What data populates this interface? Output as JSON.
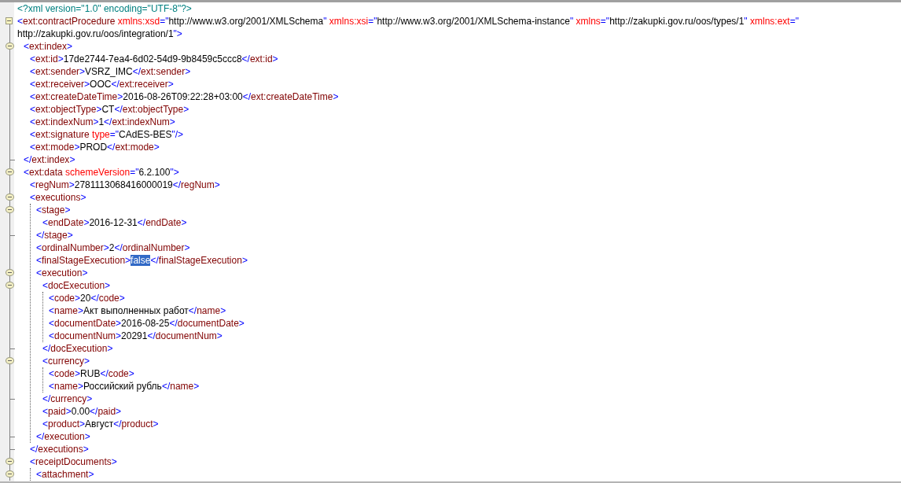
{
  "document": [
    {
      "lines": [
        [
          {
            "decl": "<?xml version=\"1.0\" encoding=\"UTF-8\"?>"
          }
        ]
      ]
    },
    {
      "expanded": true,
      "lines": [
        [
          {
            "punct": "<"
          },
          {
            "tag": "ext:contractProcedure"
          },
          {
            "attr": "xmlns:xsd"
          },
          {
            "punct": "=\""
          },
          {
            "text": "http://www.w3.org/2001/XMLSchema"
          },
          {
            "punct": "\""
          },
          {
            "attr": "xmlns:xsi"
          },
          {
            "punct": "=\""
          },
          {
            "text": "http://www.w3.org/2001/XMLSchema-instance"
          },
          {
            "punct": "\""
          },
          {
            "attr": "xmlns"
          },
          {
            "punct": "=\""
          },
          {
            "text": "http://zakupki.gov.ru/oos/types/1"
          },
          {
            "punct": "\""
          },
          {
            "attr": "xmlns:ext"
          },
          {
            "punct": "=\""
          }
        ],
        [
          {
            "text": "http://zakupki.gov.ru/oos/integration/1"
          },
          {
            "punct": "\">"
          }
        ]
      ],
      "children": [
        {
          "expanded": true,
          "lines": [
            [
              {
                "punct": "<"
              },
              {
                "tag": "ext:index"
              },
              {
                "punct": ">"
              }
            ]
          ],
          "close": [
            {
              "punct": "</"
            },
            {
              "tag": "ext:index"
            },
            {
              "punct": ">"
            }
          ],
          "children": [
            {
              "lines": [
                [
                  {
                    "punct": "<"
                  },
                  {
                    "tag": "ext:id"
                  },
                  {
                    "punct": ">"
                  },
                  {
                    "text": "17de2744-7ea4-6d02-54d9-9b8459c5ccc8"
                  },
                  {
                    "punct": "</"
                  },
                  {
                    "tag": "ext:id"
                  },
                  {
                    "punct": ">"
                  }
                ]
              ]
            },
            {
              "lines": [
                [
                  {
                    "punct": "<"
                  },
                  {
                    "tag": "ext:sender"
                  },
                  {
                    "punct": ">"
                  },
                  {
                    "text": "VSRZ_IMC"
                  },
                  {
                    "punct": "</"
                  },
                  {
                    "tag": "ext:sender"
                  },
                  {
                    "punct": ">"
                  }
                ]
              ]
            },
            {
              "lines": [
                [
                  {
                    "punct": "<"
                  },
                  {
                    "tag": "ext:receiver"
                  },
                  {
                    "punct": ">"
                  },
                  {
                    "text": "OOC"
                  },
                  {
                    "punct": "</"
                  },
                  {
                    "tag": "ext:receiver"
                  },
                  {
                    "punct": ">"
                  }
                ]
              ]
            },
            {
              "lines": [
                [
                  {
                    "punct": "<"
                  },
                  {
                    "tag": "ext:createDateTime"
                  },
                  {
                    "punct": ">"
                  },
                  {
                    "text": "2016-08-26T09:22:28+03:00"
                  },
                  {
                    "punct": "</"
                  },
                  {
                    "tag": "ext:createDateTime"
                  },
                  {
                    "punct": ">"
                  }
                ]
              ]
            },
            {
              "lines": [
                [
                  {
                    "punct": "<"
                  },
                  {
                    "tag": "ext:objectType"
                  },
                  {
                    "punct": ">"
                  },
                  {
                    "text": "CT"
                  },
                  {
                    "punct": "</"
                  },
                  {
                    "tag": "ext:objectType"
                  },
                  {
                    "punct": ">"
                  }
                ]
              ]
            },
            {
              "lines": [
                [
                  {
                    "punct": "<"
                  },
                  {
                    "tag": "ext:indexNum"
                  },
                  {
                    "punct": ">"
                  },
                  {
                    "text": "1"
                  },
                  {
                    "punct": "</"
                  },
                  {
                    "tag": "ext:indexNum"
                  },
                  {
                    "punct": ">"
                  }
                ]
              ]
            },
            {
              "lines": [
                [
                  {
                    "punct": "<"
                  },
                  {
                    "tag": "ext:signature"
                  },
                  {
                    "attr": "type"
                  },
                  {
                    "punct": "=\""
                  },
                  {
                    "text": "CAdES-BES"
                  },
                  {
                    "punct": "\"/>"
                  }
                ]
              ]
            },
            {
              "lines": [
                [
                  {
                    "punct": "<"
                  },
                  {
                    "tag": "ext:mode"
                  },
                  {
                    "punct": ">"
                  },
                  {
                    "text": "PROD"
                  },
                  {
                    "punct": "</"
                  },
                  {
                    "tag": "ext:mode"
                  },
                  {
                    "punct": ">"
                  }
                ]
              ]
            }
          ]
        },
        {
          "expanded": true,
          "lines": [
            [
              {
                "punct": "<"
              },
              {
                "tag": "ext:data"
              },
              {
                "attr": "schemeVersion"
              },
              {
                "punct": "=\""
              },
              {
                "text": "6.2.100"
              },
              {
                "punct": "\">"
              }
            ]
          ],
          "children": [
            {
              "lines": [
                [
                  {
                    "punct": "<"
                  },
                  {
                    "tag": "regNum"
                  },
                  {
                    "punct": ">"
                  },
                  {
                    "text": "2781113068416000019"
                  },
                  {
                    "punct": "</"
                  },
                  {
                    "tag": "regNum"
                  },
                  {
                    "punct": ">"
                  }
                ]
              ]
            },
            {
              "expanded": true,
              "guide": true,
              "lines": [
                [
                  {
                    "punct": "<"
                  },
                  {
                    "tag": "executions"
                  },
                  {
                    "punct": ">"
                  }
                ]
              ],
              "close": [
                {
                  "punct": "</"
                },
                {
                  "tag": "executions"
                },
                {
                  "punct": ">"
                }
              ],
              "children": [
                {
                  "expanded": true,
                  "lines": [
                    [
                      {
                        "punct": "<"
                      },
                      {
                        "tag": "stage"
                      },
                      {
                        "punct": ">"
                      }
                    ]
                  ],
                  "close": [
                    {
                      "punct": "</"
                    },
                    {
                      "tag": "stage"
                    },
                    {
                      "punct": ">"
                    }
                  ],
                  "children": [
                    {
                      "lines": [
                        [
                          {
                            "punct": "<"
                          },
                          {
                            "tag": "endDate"
                          },
                          {
                            "punct": ">"
                          },
                          {
                            "text": "2016-12-31"
                          },
                          {
                            "punct": "</"
                          },
                          {
                            "tag": "endDate"
                          },
                          {
                            "punct": ">"
                          }
                        ]
                      ]
                    }
                  ]
                },
                {
                  "lines": [
                    [
                      {
                        "punct": "<"
                      },
                      {
                        "tag": "ordinalNumber"
                      },
                      {
                        "punct": ">"
                      },
                      {
                        "text": "2"
                      },
                      {
                        "punct": "</"
                      },
                      {
                        "tag": "ordinalNumber"
                      },
                      {
                        "punct": ">"
                      }
                    ]
                  ]
                },
                {
                  "lines": [
                    [
                      {
                        "punct": "<"
                      },
                      {
                        "tag": "finalStageExecution"
                      },
                      {
                        "punct": ">"
                      },
                      {
                        "selected_text": "false"
                      },
                      {
                        "punct": "</"
                      },
                      {
                        "tag": "finalStageExecution"
                      },
                      {
                        "punct": ">"
                      }
                    ]
                  ]
                },
                {
                  "expanded": true,
                  "lines": [
                    [
                      {
                        "punct": "<"
                      },
                      {
                        "tag": "execution"
                      },
                      {
                        "punct": ">"
                      }
                    ]
                  ],
                  "close": [
                    {
                      "punct": "</"
                    },
                    {
                      "tag": "execution"
                    },
                    {
                      "punct": ">"
                    }
                  ],
                  "children": [
                    {
                      "expanded": true,
                      "guide": true,
                      "lines": [
                        [
                          {
                            "punct": "<"
                          },
                          {
                            "tag": "docExecution"
                          },
                          {
                            "punct": ">"
                          }
                        ]
                      ],
                      "close": [
                        {
                          "punct": "</"
                        },
                        {
                          "tag": "docExecution"
                        },
                        {
                          "punct": ">"
                        }
                      ],
                      "children": [
                        {
                          "lines": [
                            [
                              {
                                "punct": "<"
                              },
                              {
                                "tag": "code"
                              },
                              {
                                "punct": ">"
                              },
                              {
                                "text": "20"
                              },
                              {
                                "punct": "</"
                              },
                              {
                                "tag": "code"
                              },
                              {
                                "punct": ">"
                              }
                            ]
                          ]
                        },
                        {
                          "lines": [
                            [
                              {
                                "punct": "<"
                              },
                              {
                                "tag": "name"
                              },
                              {
                                "punct": ">"
                              },
                              {
                                "text": "Акт выполненных работ"
                              },
                              {
                                "punct": "</"
                              },
                              {
                                "tag": "name"
                              },
                              {
                                "punct": ">"
                              }
                            ]
                          ]
                        },
                        {
                          "lines": [
                            [
                              {
                                "punct": "<"
                              },
                              {
                                "tag": "documentDate"
                              },
                              {
                                "punct": ">"
                              },
                              {
                                "text": "2016-08-25"
                              },
                              {
                                "punct": "</"
                              },
                              {
                                "tag": "documentDate"
                              },
                              {
                                "punct": ">"
                              }
                            ]
                          ]
                        },
                        {
                          "lines": [
                            [
                              {
                                "punct": "<"
                              },
                              {
                                "tag": "documentNum"
                              },
                              {
                                "punct": ">"
                              },
                              {
                                "text": "20291"
                              },
                              {
                                "punct": "</"
                              },
                              {
                                "tag": "documentNum"
                              },
                              {
                                "punct": ">"
                              }
                            ]
                          ]
                        }
                      ]
                    },
                    {
                      "expanded": true,
                      "guide": true,
                      "lines": [
                        [
                          {
                            "punct": "<"
                          },
                          {
                            "tag": "currency"
                          },
                          {
                            "punct": ">"
                          }
                        ]
                      ],
                      "close": [
                        {
                          "punct": "</"
                        },
                        {
                          "tag": "currency"
                        },
                        {
                          "punct": ">"
                        }
                      ],
                      "children": [
                        {
                          "lines": [
                            [
                              {
                                "punct": "<"
                              },
                              {
                                "tag": "code"
                              },
                              {
                                "punct": ">"
                              },
                              {
                                "text": "RUB"
                              },
                              {
                                "punct": "</"
                              },
                              {
                                "tag": "code"
                              },
                              {
                                "punct": ">"
                              }
                            ]
                          ]
                        },
                        {
                          "lines": [
                            [
                              {
                                "punct": "<"
                              },
                              {
                                "tag": "name"
                              },
                              {
                                "punct": ">"
                              },
                              {
                                "text": "Российский рубль"
                              },
                              {
                                "punct": "</"
                              },
                              {
                                "tag": "name"
                              },
                              {
                                "punct": ">"
                              }
                            ]
                          ]
                        }
                      ]
                    },
                    {
                      "lines": [
                        [
                          {
                            "punct": "<"
                          },
                          {
                            "tag": "paid"
                          },
                          {
                            "punct": ">"
                          },
                          {
                            "text": "0.00"
                          },
                          {
                            "punct": "</"
                          },
                          {
                            "tag": "paid"
                          },
                          {
                            "punct": ">"
                          }
                        ]
                      ]
                    },
                    {
                      "lines": [
                        [
                          {
                            "punct": "<"
                          },
                          {
                            "tag": "product"
                          },
                          {
                            "punct": ">"
                          },
                          {
                            "text": "Август"
                          },
                          {
                            "punct": "</"
                          },
                          {
                            "tag": "product"
                          },
                          {
                            "punct": ">"
                          }
                        ]
                      ]
                    }
                  ]
                }
              ]
            },
            {
              "expanded": true,
              "guide": true,
              "lines": [
                [
                  {
                    "punct": "<"
                  },
                  {
                    "tag": "receiptDocuments"
                  },
                  {
                    "punct": ">"
                  }
                ]
              ],
              "children": [
                {
                  "expanded": true,
                  "lines": [
                    [
                      {
                        "punct": "<"
                      },
                      {
                        "tag": "attachment"
                      },
                      {
                        "punct": ">"
                      }
                    ]
                  ]
                }
              ]
            }
          ]
        }
      ]
    }
  ]
}
